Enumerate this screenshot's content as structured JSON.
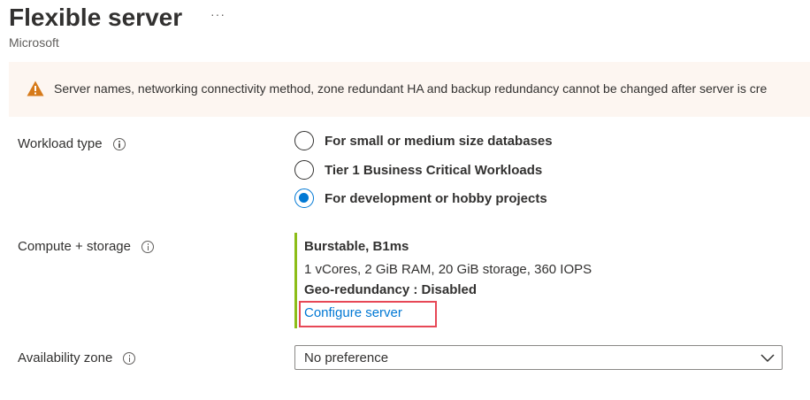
{
  "header": {
    "title": "Flexible server",
    "more": "···",
    "subtitle": "Microsoft"
  },
  "banner": {
    "icon": "warning-icon",
    "message": "Server names, networking connectivity method, zone redundant HA and backup redundancy cannot be changed after server is cre"
  },
  "workload": {
    "label": "Workload type",
    "options": [
      {
        "label": "For small or medium size databases",
        "checked": false
      },
      {
        "label": "Tier 1 Business Critical Workloads",
        "checked": false
      },
      {
        "label": "For development or hobby projects",
        "checked": true
      }
    ]
  },
  "compute": {
    "label": "Compute + storage",
    "tier": "Burstable, B1ms",
    "spec": "1 vCores, 2 GiB RAM, 20 GiB storage, 360 IOPS",
    "geo": "Geo-redundancy : Disabled",
    "configure_link": "Configure server"
  },
  "availability": {
    "label": "Availability zone",
    "selected": "No preference"
  },
  "colors": {
    "accent": "#0078d4",
    "warning": "#d67a1a",
    "banner_bg": "#fdf6f1",
    "compute_bar": "#8cbd18",
    "highlight": "#e74856"
  }
}
